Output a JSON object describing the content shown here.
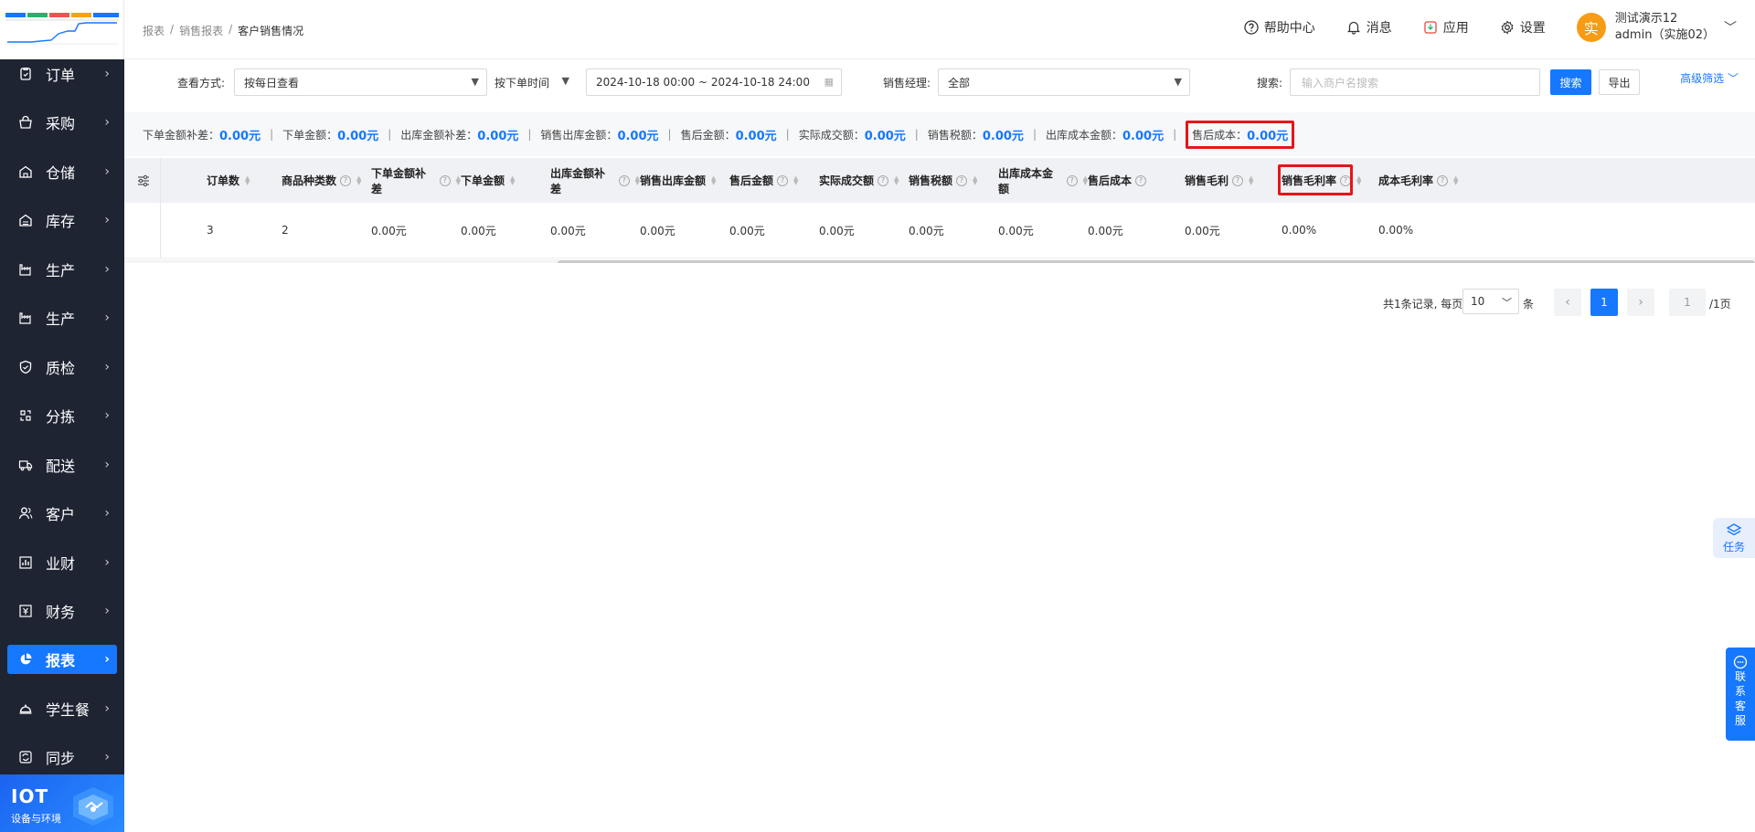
{
  "sidebar": {
    "items": [
      {
        "label": "订单",
        "icon": "order-icon"
      },
      {
        "label": "采购",
        "icon": "purchase-icon"
      },
      {
        "label": "仓储",
        "icon": "warehouse-icon"
      },
      {
        "label": "库存",
        "icon": "inventory-icon"
      },
      {
        "label": "生产",
        "icon": "factory-icon"
      },
      {
        "label": "生产",
        "icon": "factory-icon"
      },
      {
        "label": "质检",
        "icon": "shield-check-icon"
      },
      {
        "label": "分拣",
        "icon": "sort-icon"
      },
      {
        "label": "配送",
        "icon": "truck-icon"
      },
      {
        "label": "客户",
        "icon": "customer-icon"
      },
      {
        "label": "业财",
        "icon": "bar-chart-icon"
      },
      {
        "label": "财务",
        "icon": "finance-icon"
      },
      {
        "label": "报表",
        "icon": "pie-chart-icon",
        "active": true
      },
      {
        "label": "学生餐",
        "icon": "dish-cover-icon"
      },
      {
        "label": "同步",
        "icon": "sync-icon"
      }
    ],
    "iot": {
      "title": "IOT",
      "subtitle": "设备与环境"
    }
  },
  "header": {
    "breadcrumb": [
      "报表",
      "销售报表",
      "客户销售情况"
    ],
    "help": "帮助中心",
    "messages": "消息",
    "apps": "应用",
    "settings": "设置",
    "avatar_char": "实",
    "user_name": "测试演示12",
    "user_account": "admin（实施02）"
  },
  "filters": {
    "view_mode_label": "查看方式:",
    "view_mode_value": "按每日查看",
    "time_type_value": "按下单时间",
    "date_range": "2024-10-18 00:00 ~ 2024-10-18 24:00",
    "manager_label": "销售经理:",
    "manager_value": "全部",
    "search_label": "搜索:",
    "search_placeholder": "输入商户名搜索",
    "search_button": "搜索",
    "export_button": "导出",
    "advanced": "高级筛选"
  },
  "summary": [
    {
      "label": "下单金额补差：",
      "value": "0.00元"
    },
    {
      "label": "下单金额：",
      "value": "0.00元"
    },
    {
      "label": "出库金额补差：",
      "value": "0.00元"
    },
    {
      "label": "销售出库金额：",
      "value": "0.00元"
    },
    {
      "label": "售后金额：",
      "value": "0.00元"
    },
    {
      "label": "实际成交额：",
      "value": "0.00元"
    },
    {
      "label": "销售税额：",
      "value": "0.00元"
    },
    {
      "label": "出库成本金额：",
      "value": "0.00元"
    },
    {
      "label": "售后成本：",
      "value": "0.00元",
      "highlight": true
    }
  ],
  "table": {
    "columns": [
      "订单数",
      "商品种类数",
      "下单金额补差",
      "下单金额",
      "出库金额补差",
      "销售出库金额",
      "售后金额",
      "实际成交额",
      "销售税额",
      "出库成本金额",
      "售后成本",
      "销售毛利",
      "销售毛利率",
      "成本毛利率"
    ],
    "rows": [
      [
        "3",
        "2",
        "0.00元",
        "0.00元",
        "0.00元",
        "0.00元",
        "0.00元",
        "0.00元",
        "0.00元",
        "0.00元",
        "0.00元",
        "0.00元",
        "0.00%",
        "0.00%"
      ]
    ]
  },
  "pagination": {
    "total_text": "共1条记录, 每页",
    "page_size": "10",
    "unit": "条",
    "current_page": "1",
    "jump_value": "1",
    "total_pages": "/1页"
  },
  "floating": {
    "task": "任务",
    "customer_service": [
      "联",
      "系",
      "客",
      "服"
    ]
  },
  "colors": {
    "accent": "#1677ff",
    "sidebar_bg": "#1f2433",
    "highlight_border": "#e8141a"
  }
}
